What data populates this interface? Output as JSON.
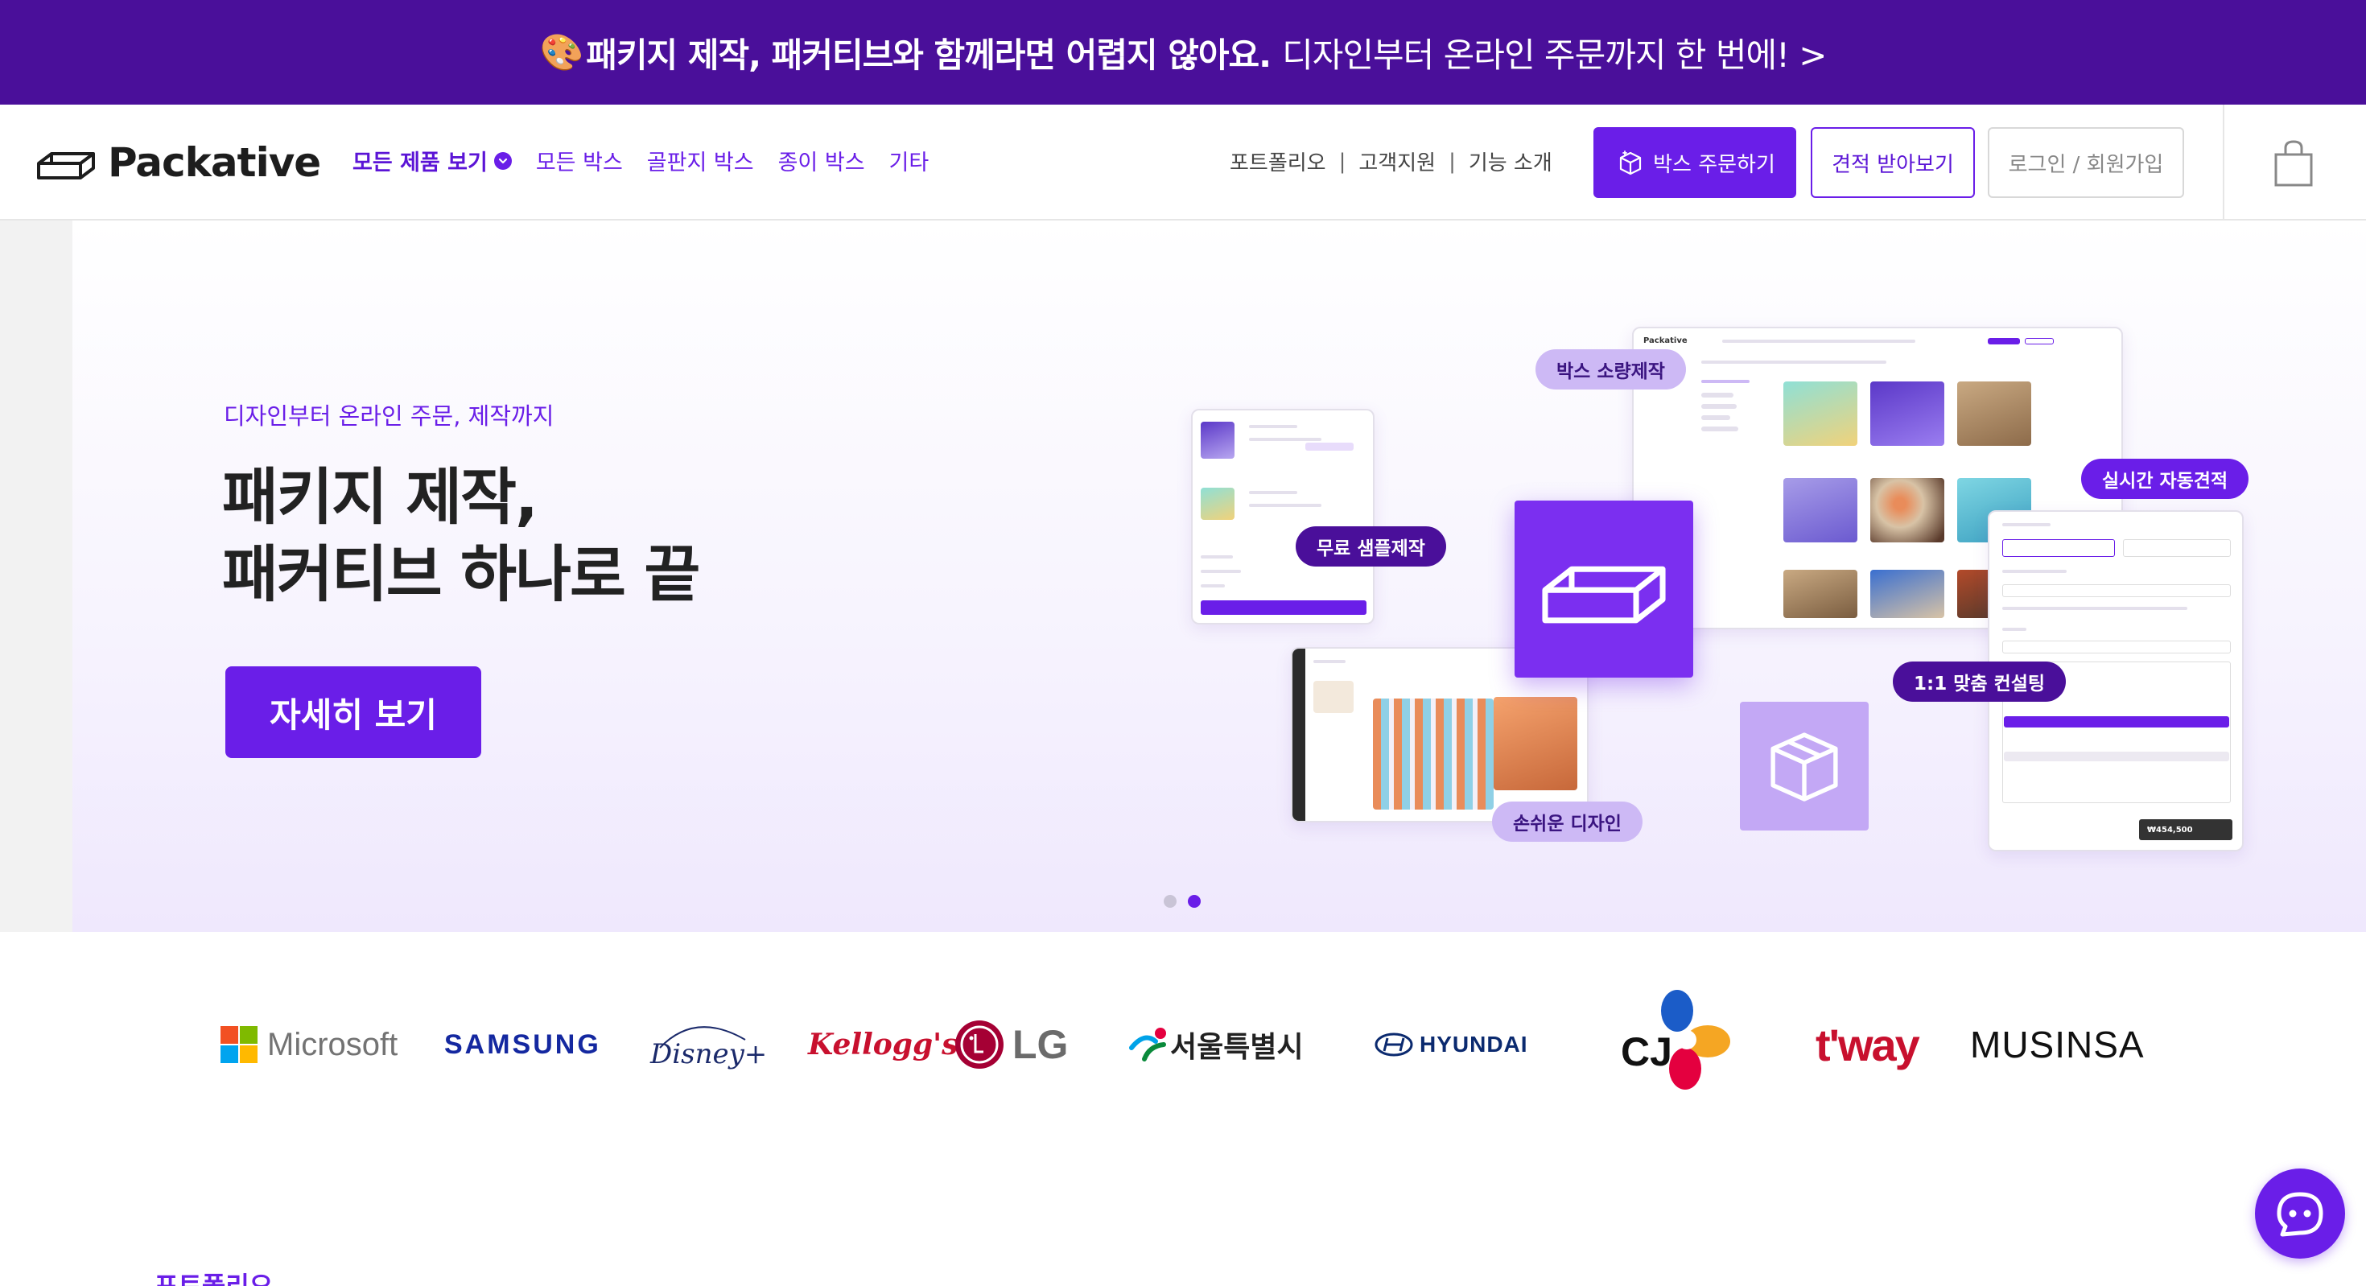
{
  "promo": {
    "emoji": "🎨",
    "bold_text": "패키지 제작, 패커티브와 함께라면 어렵지 않아요.",
    "rest_text": "디자인부터 온라인 주문까지 한 번에! >"
  },
  "header": {
    "logo_text": "Packative",
    "nav": [
      "모든 제품 보기",
      "모든 박스",
      "골판지 박스",
      "종이 박스",
      "기타"
    ],
    "util_links": [
      "포트폴리오",
      "고객지원",
      "기능 소개"
    ],
    "util_separator": "|",
    "order_button": "박스 주문하기",
    "quote_button": "견적 받아보기",
    "login_button": "로그인 / 회원가입"
  },
  "hero": {
    "subtitle": "디자인부터 온라인 주문, 제작까지",
    "title_line1": "패키지 제작,",
    "title_line2": "패커티브 하나로 끝",
    "cta": "자세히 보기",
    "pills": {
      "bulk": "박스 소량제작",
      "auto_quote": "실시간 자동견적",
      "free_sample": "무료 샘플제작",
      "consulting": "1:1 맞춤 컨설팅",
      "easy_design": "손쉬운 디자인"
    },
    "mock_app_logo": "Packative",
    "mock_price": "₩454,500",
    "carousel": {
      "current": 2,
      "total": 2
    }
  },
  "clients": {
    "microsoft": "Microsoft",
    "samsung": "SAMSUNG",
    "disney": "Disney+",
    "kelloggs": "Kellogg's",
    "lg": "LG",
    "seoul": "서울특별시",
    "hyundai": "HYUNDAI",
    "cj": "CJ",
    "tway": "t'way",
    "musinsa": "MUSINSA"
  },
  "next_section": {
    "title": "포트폴리오"
  },
  "colors": {
    "brand_purple": "#6a1ee8",
    "banner_purple": "#4a0f9a",
    "pill_light": "#cdb9f5"
  },
  "icons": {
    "logo": "packative-logo-icon",
    "nav_chevron": "chevron-down-icon",
    "order": "box-icon",
    "cart": "shopping-bag-icon",
    "chat": "chatbot-icon"
  }
}
